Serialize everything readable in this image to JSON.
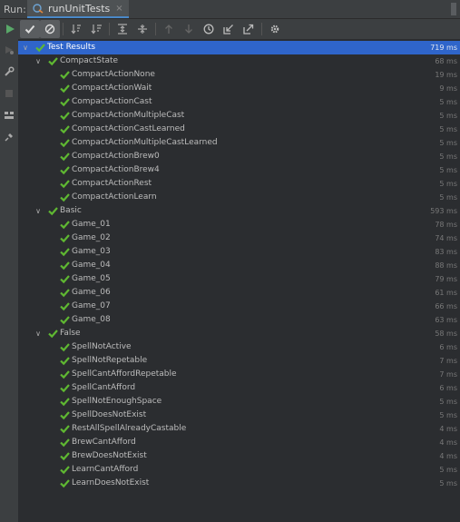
{
  "tabbar": {
    "run_label": "Run:",
    "tab_title": "runUnitTests",
    "close": "×"
  },
  "tree": {
    "root": {
      "name": "Test Results",
      "duration": "719 ms"
    },
    "suites": [
      {
        "name": "CompactState",
        "duration": "68 ms",
        "tests": [
          {
            "name": "CompactActionNone",
            "duration": "19 ms"
          },
          {
            "name": "CompactActionWait",
            "duration": "9 ms"
          },
          {
            "name": "CompactActionCast",
            "duration": "5 ms"
          },
          {
            "name": "CompactActionMultipleCast",
            "duration": "5 ms"
          },
          {
            "name": "CompactActionCastLearned",
            "duration": "5 ms"
          },
          {
            "name": "CompactActionMultipleCastLearned",
            "duration": "5 ms"
          },
          {
            "name": "CompactActionBrew0",
            "duration": "5 ms"
          },
          {
            "name": "CompactActionBrew4",
            "duration": "5 ms"
          },
          {
            "name": "CompactActionRest",
            "duration": "5 ms"
          },
          {
            "name": "CompactActionLearn",
            "duration": "5 ms"
          }
        ]
      },
      {
        "name": "Basic",
        "duration": "593 ms",
        "tests": [
          {
            "name": "Game_01",
            "duration": "78 ms"
          },
          {
            "name": "Game_02",
            "duration": "74 ms"
          },
          {
            "name": "Game_03",
            "duration": "83 ms"
          },
          {
            "name": "Game_04",
            "duration": "88 ms"
          },
          {
            "name": "Game_05",
            "duration": "79 ms"
          },
          {
            "name": "Game_06",
            "duration": "61 ms"
          },
          {
            "name": "Game_07",
            "duration": "66 ms"
          },
          {
            "name": "Game_08",
            "duration": "63 ms"
          }
        ]
      },
      {
        "name": "False",
        "duration": "58 ms",
        "tests": [
          {
            "name": "SpellNotActive",
            "duration": "6 ms"
          },
          {
            "name": "SpellNotRepetable",
            "duration": "7 ms"
          },
          {
            "name": "SpellCantAffordRepetable",
            "duration": "7 ms"
          },
          {
            "name": "SpellCantAfford",
            "duration": "6 ms"
          },
          {
            "name": "SpellNotEnoughSpace",
            "duration": "5 ms"
          },
          {
            "name": "SpellDoesNotExist",
            "duration": "5 ms"
          },
          {
            "name": "RestAllSpellAlreadyCastable",
            "duration": "4 ms"
          },
          {
            "name": "BrewCantAfford",
            "duration": "4 ms"
          },
          {
            "name": "BrewDoesNotExist",
            "duration": "4 ms"
          },
          {
            "name": "LearnCantAfford",
            "duration": "5 ms"
          },
          {
            "name": "LearnDoesNotExist",
            "duration": "5 ms"
          }
        ]
      }
    ]
  },
  "colors": {
    "accent": "#2f65ca",
    "pass": "#5fb832",
    "run": "#59a869"
  },
  "icons": {
    "toolbar": [
      "run-icon",
      "show-passed-icon",
      "show-ignored-icon",
      "sort-alpha-icon",
      "sort-duration-icon",
      "expand-all-icon",
      "collapse-all-icon",
      "previous-icon",
      "next-icon",
      "history-icon",
      "import-icon",
      "export-icon",
      "settings-icon"
    ],
    "sidebar": [
      "rerun-failed-icon",
      "wrench-icon",
      "stop-icon",
      "layout-icon",
      "pin-icon"
    ]
  }
}
